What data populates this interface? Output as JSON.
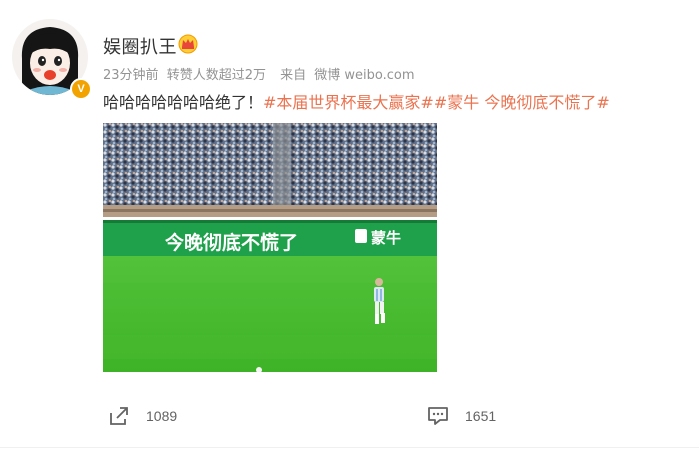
{
  "user": {
    "name": "娱圈扒王",
    "verified_badge": "V",
    "avatar_icon": "cartoon-girl-avatar",
    "crown_icon": "crown-badge-icon"
  },
  "post": {
    "time": "23分钟前",
    "reposts_note": "转赞人数超过2万",
    "source_prefix": "来自",
    "source_app": "微博 weibo.com",
    "text_plain": "哈哈哈哈哈哈哈绝了！",
    "hashtag_1": "#本届世界杯最大赢家#",
    "hashtag_2": "#蒙牛 今晚彻底不慌了#",
    "image": {
      "board_text": "今晚彻底不慌了",
      "brand_text": "蒙牛"
    }
  },
  "actions": {
    "repost_count": "1089",
    "comment_count": "1651"
  },
  "colors": {
    "hashtag": "#eb7350",
    "meta": "#939393",
    "badge": "#f3a300"
  }
}
